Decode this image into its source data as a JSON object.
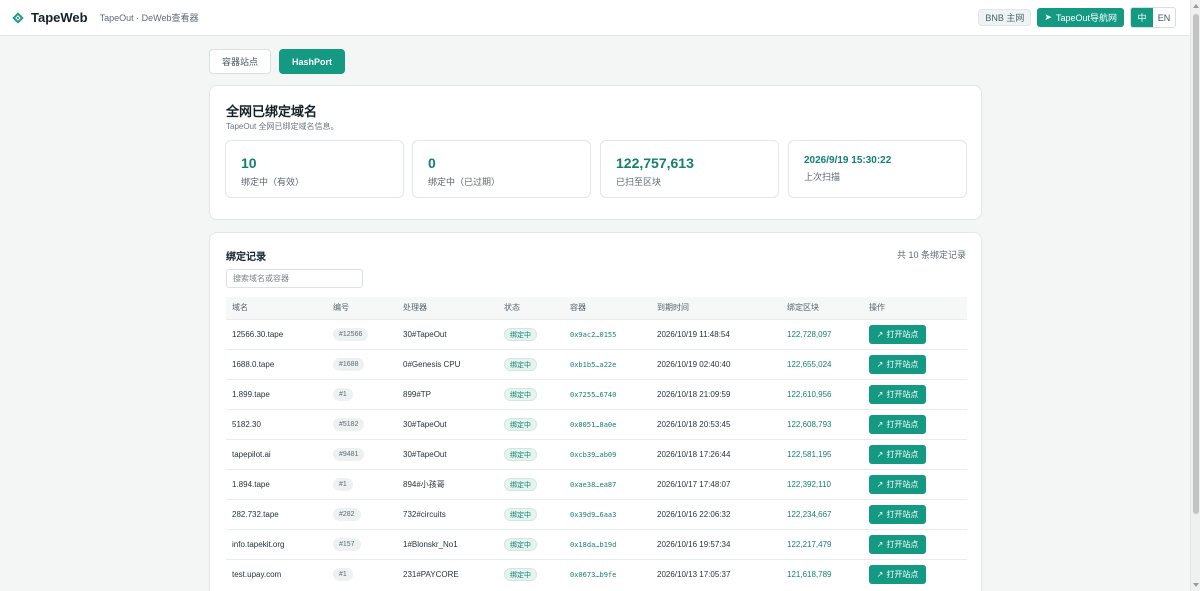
{
  "header": {
    "brand": "TapeWeb",
    "subtitle": "TapeOut · DeWeb查看器",
    "network": "BNB 主网",
    "nav_button": "TapeOut导航网",
    "lang_active": "中",
    "lang_other": "EN"
  },
  "tabs": [
    {
      "label": "容器站点",
      "active": false
    },
    {
      "label": "HashPort",
      "active": true
    }
  ],
  "overview": {
    "title": "全网已绑定域名",
    "description": "TapeOut 全网已绑定域名信息。",
    "stats": [
      {
        "value": "10",
        "label": "绑定中（有效）"
      },
      {
        "value": "0",
        "label": "绑定中（已过期）"
      },
      {
        "value": "122,757,613",
        "label": "已扫至区块"
      },
      {
        "value": "2026/9/19 15:30:22",
        "label": "上次扫描"
      }
    ]
  },
  "records": {
    "title": "绑定记录",
    "count_text": "共 10 条绑定记录",
    "search_placeholder": "搜索域名或容器",
    "columns": [
      "域名",
      "编号",
      "处理器",
      "状态",
      "容器",
      "到期时间",
      "绑定区块",
      "操作"
    ],
    "open_label": "打开站点",
    "rows": [
      {
        "domain": "12566.30.tape",
        "id": "#12566",
        "processor": "30#TapeOut",
        "status": "绑定中",
        "container": "0x9ac2…0155",
        "expires": "2026/10/19 11:48:54",
        "block": "122,728,097"
      },
      {
        "domain": "1688.0.tape",
        "id": "#1688",
        "processor": "0#Genesis CPU",
        "status": "绑定中",
        "container": "0xb1b5…a22e",
        "expires": "2026/10/19 02:40:40",
        "block": "122,655,024"
      },
      {
        "domain": "1.899.tape",
        "id": "#1",
        "processor": "899#TP",
        "status": "绑定中",
        "container": "0x7255…6740",
        "expires": "2026/10/18 21:09:59",
        "block": "122,610,956"
      },
      {
        "domain": "5182.30",
        "id": "#5182",
        "processor": "30#TapeOut",
        "status": "绑定中",
        "container": "0x8051…8a0e",
        "expires": "2026/10/18 20:53:45",
        "block": "122,608,793"
      },
      {
        "domain": "tapepilot.ai",
        "id": "#9481",
        "processor": "30#TapeOut",
        "status": "绑定中",
        "container": "0xcb39…ab09",
        "expires": "2026/10/18 17:26:44",
        "block": "122,581,195"
      },
      {
        "domain": "1.894.tape",
        "id": "#1",
        "processor": "894#小孩哥",
        "status": "绑定中",
        "container": "0xae38…ea87",
        "expires": "2026/10/17 17:48:07",
        "block": "122,392,110"
      },
      {
        "domain": "282.732.tape",
        "id": "#282",
        "processor": "732#circuits",
        "status": "绑定中",
        "container": "0x39d9…6aa3",
        "expires": "2026/10/16 22:06:32",
        "block": "122,234,667"
      },
      {
        "domain": "info.tapekit.org",
        "id": "#157",
        "processor": "1#Blonskr_No1",
        "status": "绑定中",
        "container": "0x18da…b19d",
        "expires": "2026/10/16 19:57:34",
        "block": "122,217,479"
      },
      {
        "domain": "test.upay.com",
        "id": "#1",
        "processor": "231#PAYCORE",
        "status": "绑定中",
        "container": "0x0673…b9fe",
        "expires": "2026/10/13 17:05:37",
        "block": "121,618,789"
      }
    ]
  }
}
